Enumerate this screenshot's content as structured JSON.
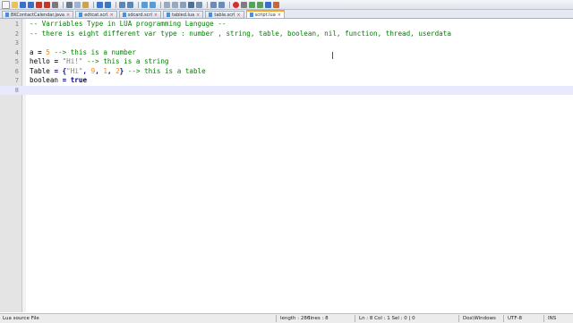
{
  "tabs": [
    {
      "label": "BKContactCalendar.java"
    },
    {
      "label": "edtcat.scrl"
    },
    {
      "label": "sdcard.scrl"
    },
    {
      "label": "tabled.lua"
    },
    {
      "label": "table.scrl"
    },
    {
      "label": "script.lua",
      "active": true
    }
  ],
  "editor": {
    "lines": [
      {
        "number": "1",
        "tokens": [
          {
            "t": "-- Varriables Type in LUA programming Languge --",
            "c": "cmt"
          }
        ]
      },
      {
        "number": "2",
        "tokens": [
          {
            "t": "-- there is eight different var type : number , string, table, boolean, nil, function, thread, userdata",
            "c": "cmt"
          }
        ]
      },
      {
        "number": "3",
        "tokens": []
      },
      {
        "number": "4",
        "tokens": [
          {
            "t": "a ",
            "c": "id"
          },
          {
            "t": "=",
            "c": "op"
          },
          {
            "t": " 5 ",
            "c": "num"
          },
          {
            "t": "--> this is a number",
            "c": "cmt"
          }
        ]
      },
      {
        "number": "5",
        "tokens": [
          {
            "t": "hello ",
            "c": "id"
          },
          {
            "t": "=",
            "c": "op"
          },
          {
            "t": " \"Hi!\" ",
            "c": "str"
          },
          {
            "t": "--> this is a string",
            "c": "cmt"
          }
        ]
      },
      {
        "number": "6",
        "tokens": [
          {
            "t": "Table ",
            "c": "id"
          },
          {
            "t": "=",
            "c": "op"
          },
          {
            "t": " {",
            "c": "op"
          },
          {
            "t": "\"Hi\"",
            "c": "str"
          },
          {
            "t": ", ",
            "c": "op"
          },
          {
            "t": "9",
            "c": "num"
          },
          {
            "t": ", ",
            "c": "op"
          },
          {
            "t": "1",
            "c": "num"
          },
          {
            "t": ", ",
            "c": "op"
          },
          {
            "t": "2",
            "c": "num"
          },
          {
            "t": "} ",
            "c": "op"
          },
          {
            "t": "--> this is a table",
            "c": "cmt"
          }
        ]
      },
      {
        "number": "7",
        "tokens": [
          {
            "t": "boolean ",
            "c": "id"
          },
          {
            "t": "=",
            "c": "op"
          },
          {
            "t": " true",
            "c": "kw"
          }
        ]
      },
      {
        "number": "8",
        "tokens": [],
        "current": true
      }
    ]
  },
  "status": {
    "file_type": "Lua source File",
    "length": "length : 286",
    "lines": "lines : 8",
    "position": "Ln : 8    Col : 1    Sel : 0 | 0",
    "eol": "Dos\\Windows",
    "encoding": "UTF-8",
    "mode": "INS"
  },
  "colors": {
    "comment": "#008000",
    "number": "#ff8000",
    "string": "#808080",
    "keyword": "#000080"
  }
}
